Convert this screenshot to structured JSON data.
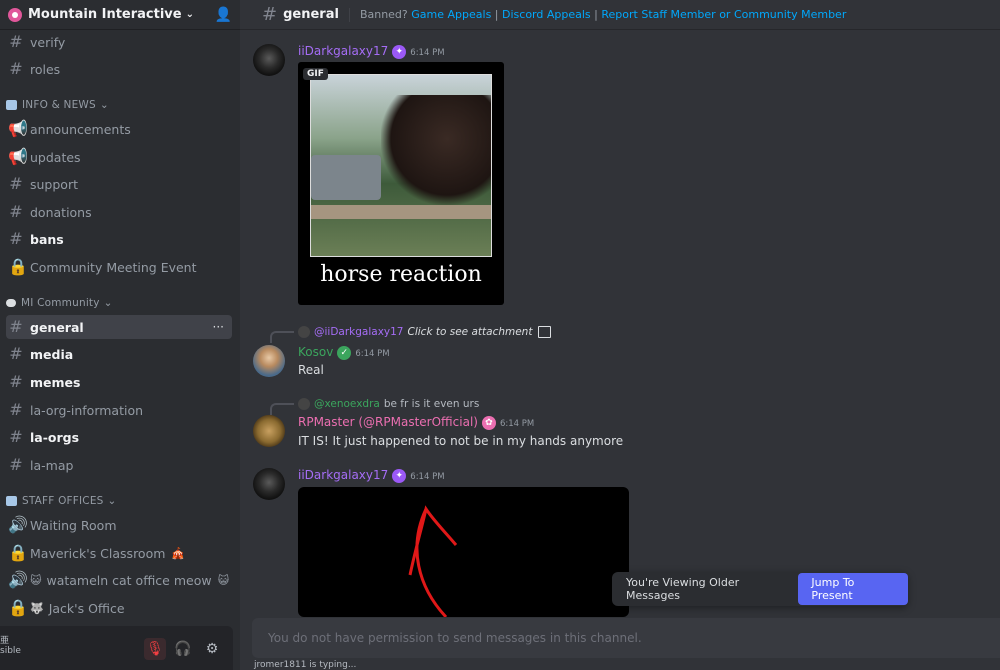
{
  "server": {
    "name": "Mountain Interactive"
  },
  "channels_top": [
    {
      "label": "verify"
    },
    {
      "label": "roles"
    }
  ],
  "categories": {
    "info_news": "INFO & NEWS",
    "mi_community": "MI Community",
    "staff_offices": "STAFF OFFICES"
  },
  "info_channels": [
    {
      "label": "announcements",
      "icon": "megaphone-icon"
    },
    {
      "label": "updates",
      "icon": "megaphone-icon"
    },
    {
      "label": "support",
      "icon": "hash-icon"
    },
    {
      "label": "donations",
      "icon": "hash-icon"
    },
    {
      "label": "bans",
      "icon": "hash-icon"
    },
    {
      "label": "Community Meeting Event",
      "icon": "lock-icon"
    }
  ],
  "community_channels": [
    {
      "label": "general"
    },
    {
      "label": "media"
    },
    {
      "label": "memes"
    },
    {
      "label": "la-org-information"
    },
    {
      "label": "la-orgs"
    },
    {
      "label": "la-map"
    }
  ],
  "staff_channels": [
    {
      "label": "Waiting Room",
      "emoji": ""
    },
    {
      "label": "Maverick's Classroom",
      "emoji": "🎪"
    },
    {
      "label": "watameln cat office meow",
      "emoji": "😺"
    },
    {
      "label": "Jack's Office",
      "emoji": ""
    }
  ],
  "staff_extra_emoji": {
    "watameln_prefix": "😺",
    "jack_prefix": "🐺"
  },
  "user_bar": {
    "status_line1": "亜",
    "status_line2": "sible"
  },
  "header": {
    "channel": "general",
    "topic_prefix": "Banned?",
    "topic_links": [
      "Game Appeals",
      "Discord Appeals",
      "Report Staff Member or Community Member"
    ],
    "topic_sep": "|"
  },
  "messages": {
    "m1": {
      "author": "iiDarkgalaxy17",
      "time": "6:14 PM",
      "gif_tag": "GIF",
      "caption": "horse reaction"
    },
    "m2": {
      "reply_name": "@iiDarkgalaxy17",
      "reply_text": "Click to see attachment",
      "author": "Kosov",
      "time": "6:14 PM",
      "text": "Real"
    },
    "m3": {
      "reply_name": "@xenoexdra",
      "reply_text": "be fr is it even urs",
      "author": "RPMaster (@RPMasterOfficial)",
      "time": "6:14 PM",
      "text": "IT IS! It just happened to not be in my hands anymore"
    },
    "m4": {
      "author": "iiDarkgalaxy17",
      "time": "6:14 PM"
    }
  },
  "older": {
    "text": "You're Viewing Older Messages",
    "button": "Jump To Present"
  },
  "composer": {
    "placeholder": "You do not have permission to send messages in this channel."
  },
  "typing": {
    "text": "jromer1811 is typing..."
  },
  "colors": {
    "accent": "#5865f2",
    "author_purple": "#a56df5",
    "kosov_green": "#3ba55d",
    "rp_pink": "#eb6fb1",
    "link": "#00a8fc"
  }
}
